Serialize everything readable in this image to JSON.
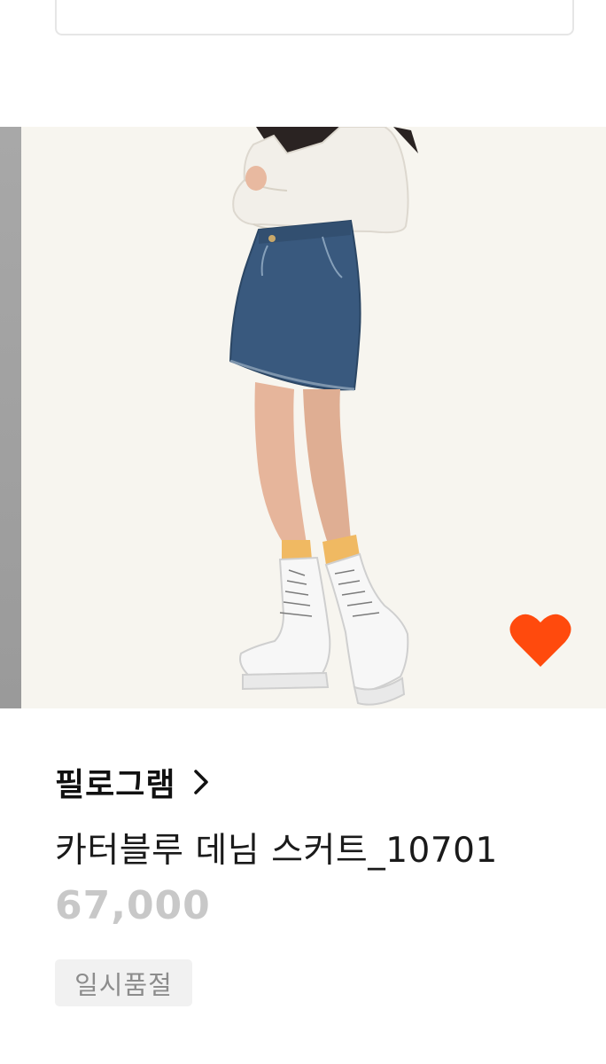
{
  "product": {
    "brand": "필로그램",
    "title": "카터블루 데님 스커트_10701",
    "price": "67,000",
    "status_badge": "일시품절",
    "wishlisted": true
  },
  "icons": {
    "brand_arrow": "chevron-right-icon",
    "wishlist": "heart-icon"
  },
  "colors": {
    "heart": "#ff4a0d",
    "price": "#c8c8c8",
    "badge_bg": "#f1f1f1",
    "photo_bg": "#f7f5ef"
  }
}
